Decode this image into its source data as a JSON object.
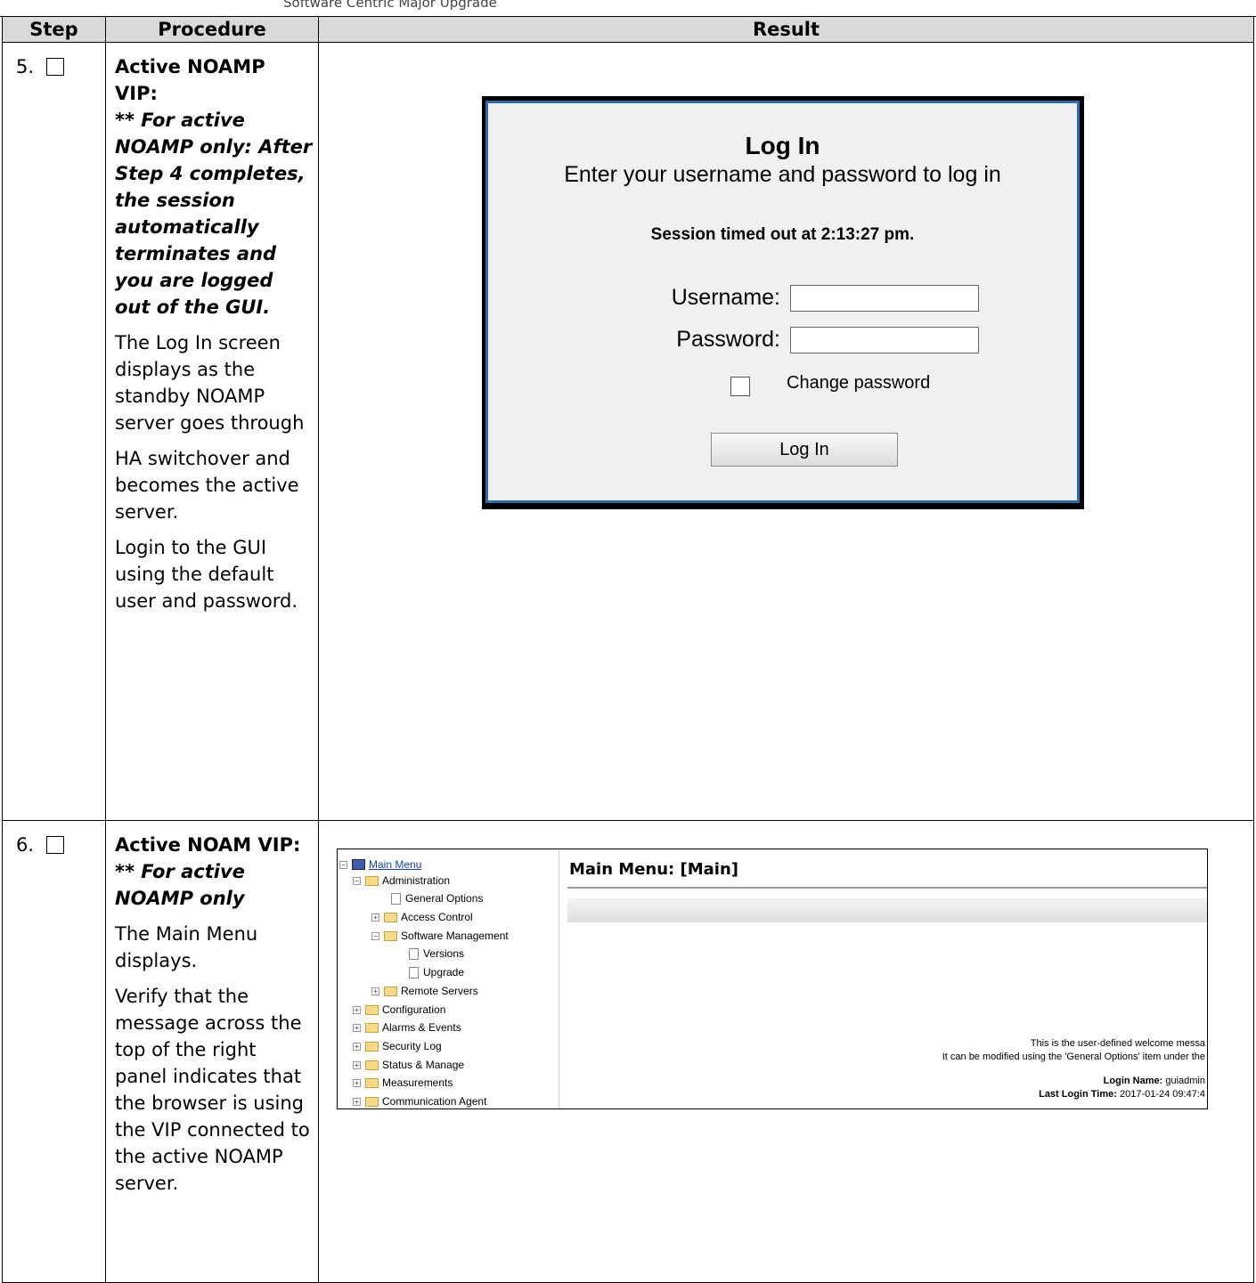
{
  "header": {
    "running_text": "Software Centric Major Upgrade"
  },
  "table": {
    "col_step": "Step",
    "col_procedure": "Procedure",
    "col_result": "Result"
  },
  "step5": {
    "number": "5.",
    "title": "Active NOAMP VIP:",
    "note": "** For active NOAMP only: After Step 4 completes, the session automatically terminates and you are logged out of the GUI.",
    "p1": "The Log In screen displays as the standby NOAMP server goes through",
    "p2": "HA switchover and becomes the active server.",
    "p3": "Login to the GUI using the default user and password.",
    "login": {
      "title": "Log In",
      "subtitle": "Enter your username and password to log in",
      "timeout": "Session timed out at 2:13:27 pm.",
      "username_label": "Username:",
      "password_label": "Password:",
      "change_password": "Change password",
      "button": "Log In"
    }
  },
  "step6": {
    "number": "6.",
    "title": "Active NOAM VIP:",
    "note": "** For active NOAMP only",
    "p1": "The Main Menu displays.",
    "p2": "Verify that the message across the top of the right panel indicates that the browser is using the VIP connected to the active NOAMP server.",
    "menu": {
      "root": "Main Menu",
      "administration": "Administration",
      "general_options": "General Options",
      "access_control": "Access Control",
      "software_management": "Software Management",
      "versions": "Versions",
      "upgrade": "Upgrade",
      "remote_servers": "Remote Servers",
      "configuration": "Configuration",
      "alarms_events": "Alarms & Events",
      "security_log": "Security Log",
      "status_manage": "Status & Manage",
      "measurements": "Measurements",
      "communication_agent": "Communication Agent"
    },
    "panel": {
      "title": "Main Menu: [Main]",
      "welcome_1": "This is the user-defined welcome messa",
      "welcome_2": "It can be modified using the 'General Options' item under the",
      "login_name_label": "Login Name:",
      "login_name_value": "guiadmin",
      "last_login_label": "Last Login Time:",
      "last_login_value": "2017-01-24 09:47:4"
    }
  }
}
